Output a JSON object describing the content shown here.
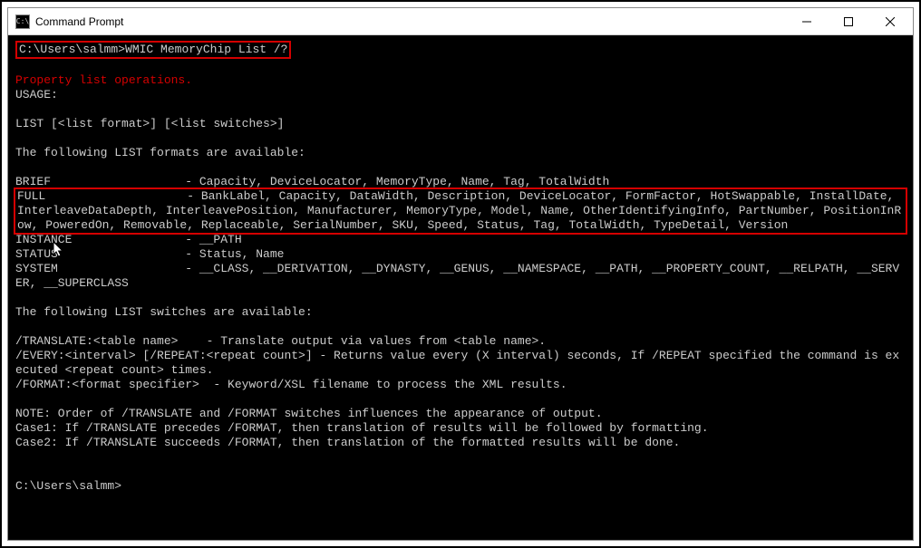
{
  "window": {
    "title": "Command Prompt"
  },
  "console": {
    "prompt1_path": "C:\\Users\\salmm>",
    "prompt1_cmd": "WMIC MemoryChip List /?",
    "blank": "",
    "property_list": "Property list operations.",
    "usage": "USAGE:",
    "list_syntax": "LIST [<list format>] [<list switches>]",
    "formats_header": "The following LIST formats are available:",
    "brief": "BRIEF                   - Capacity, DeviceLocator, MemoryType, Name, Tag, TotalWidth",
    "full": "FULL                    - BankLabel, Capacity, DataWidth, Description, DeviceLocator, FormFactor, HotSwappable, InstallDate, InterleaveDataDepth, InterleavePosition, Manufacturer, MemoryType, Model, Name, OtherIdentifyingInfo, PartNumber, PositionInRow, PoweredOn, Removable, Replaceable, SerialNumber, SKU, Speed, Status, Tag, TotalWidth, TypeDetail, Version",
    "instance": "INSTANCE                - __PATH",
    "status": "STATUS                  - Status, Name",
    "system": "SYSTEM                  - __CLASS, __DERIVATION, __DYNASTY, __GENUS, __NAMESPACE, __PATH, __PROPERTY_COUNT, __RELPATH, __SERVER, __SUPERCLASS",
    "switches_header": "The following LIST switches are available:",
    "translate": "/TRANSLATE:<table name>    - Translate output via values from <table name>.",
    "every": "/EVERY:<interval> [/REPEAT:<repeat count>] - Returns value every (X interval) seconds, If /REPEAT specified the command is executed <repeat count> times.",
    "format": "/FORMAT:<format specifier>  - Keyword/XSL filename to process the XML results.",
    "note": "NOTE: Order of /TRANSLATE and /FORMAT switches influences the appearance of output.",
    "case1": "Case1: If /TRANSLATE precedes /FORMAT, then translation of results will be followed by formatting.",
    "case2": "Case2: If /TRANSLATE succeeds /FORMAT, then translation of the formatted results will be done.",
    "prompt2": "C:\\Users\\salmm>"
  }
}
